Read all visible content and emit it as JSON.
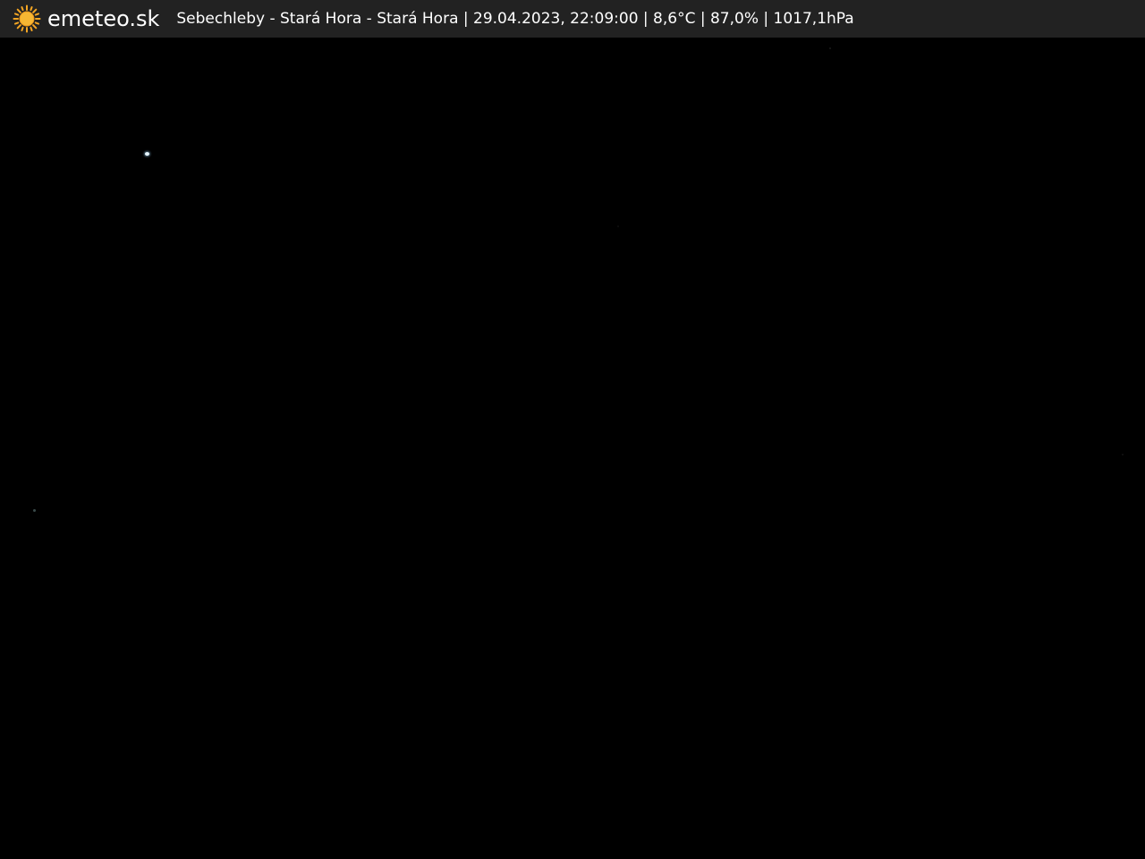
{
  "header": {
    "brand": "emeteo.sk",
    "logo_icon": "sun-icon",
    "logo_color": "#f5a623",
    "caption": "Sebechleby - Stará Hora - Stará Hora | 29.04.2023, 22:09:00 | 8,6°C | 87,0% | 1017,1hPa"
  },
  "colors": {
    "bar_background": "#222222",
    "scene_background": "#000000",
    "text": "#ffffff"
  }
}
